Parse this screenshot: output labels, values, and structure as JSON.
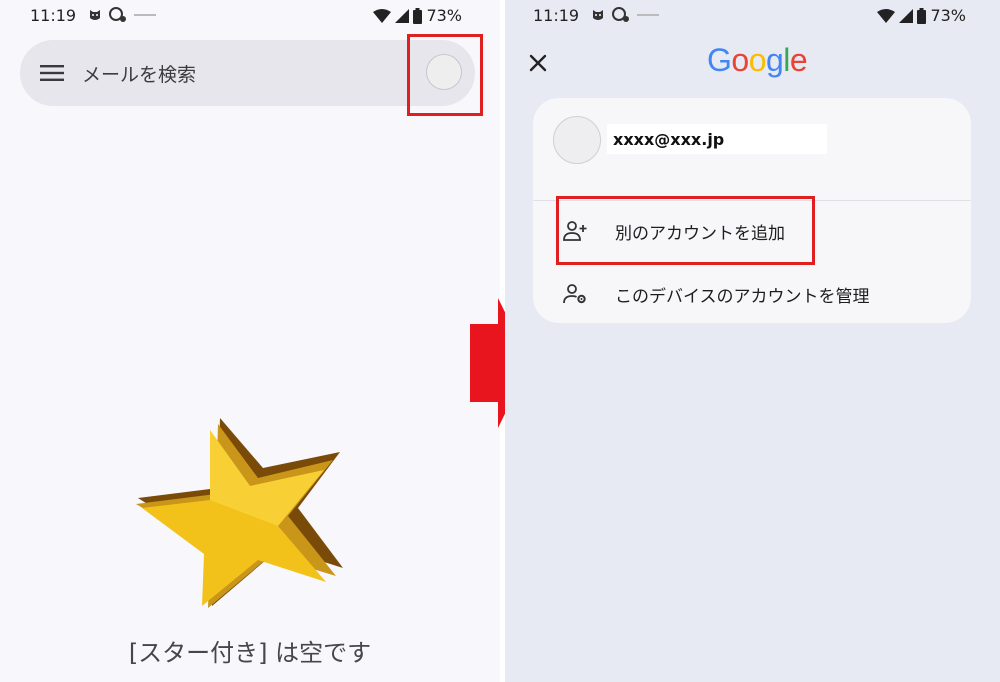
{
  "left": {
    "status": {
      "time": "11:19",
      "battery": "73%"
    },
    "search": {
      "placeholder": "メールを検索"
    },
    "empty_message": "[スター付き] は空です"
  },
  "right": {
    "status": {
      "time": "11:19",
      "battery": "73%"
    },
    "logo": {
      "letters": [
        "G",
        "o",
        "o",
        "g",
        "l",
        "e"
      ]
    },
    "account": {
      "email": "xxxx@xxx.jp"
    },
    "menu": {
      "add_account": "別のアカウントを追加",
      "manage_accounts": "このデバイスのアカウントを管理"
    }
  },
  "colors": {
    "highlight": "#e02020",
    "arrow": "#e8141e",
    "star": "#f2c21b",
    "google_blue": "#4285F4",
    "google_red": "#EA4335",
    "google_yellow": "#FBBC05",
    "google_green": "#34A853"
  }
}
